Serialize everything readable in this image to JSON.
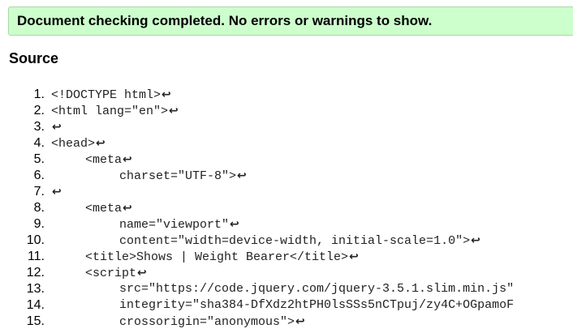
{
  "status_banner": {
    "message": "Document checking completed. No errors or warnings to show."
  },
  "source": {
    "heading": "Source",
    "linefeed_symbol": "↩",
    "lines": [
      {
        "num": "1.",
        "code": "<!DOCTYPE html>"
      },
      {
        "num": "2.",
        "code": "<html lang=\"en\">"
      },
      {
        "num": "3.",
        "code": ""
      },
      {
        "num": "4.",
        "code": "<head>"
      },
      {
        "num": "5.",
        "code": "<meta"
      },
      {
        "num": "6.",
        "code": "charset=\"UTF-8\">"
      },
      {
        "num": "7.",
        "code": ""
      },
      {
        "num": "8.",
        "code": "<meta"
      },
      {
        "num": "9.",
        "code": "name=\"viewport\""
      },
      {
        "num": "10.",
        "code": "content=\"width=device-width, initial-scale=1.0\">"
      },
      {
        "num": "11.",
        "code": "<title>Shows | Weight Bearer</title>"
      },
      {
        "num": "12.",
        "code": "<script"
      },
      {
        "num": "13.",
        "code": "src=\"https://code.jquery.com/jquery-3.5.1.slim.min.js\""
      },
      {
        "num": "14.",
        "code": "integrity=\"sha384-DfXdz2htPH0lsSSs5nCTpuj/zy4C+OGpamoF"
      },
      {
        "num": "15.",
        "code": "crossorigin=\"anonymous\">"
      }
    ]
  }
}
